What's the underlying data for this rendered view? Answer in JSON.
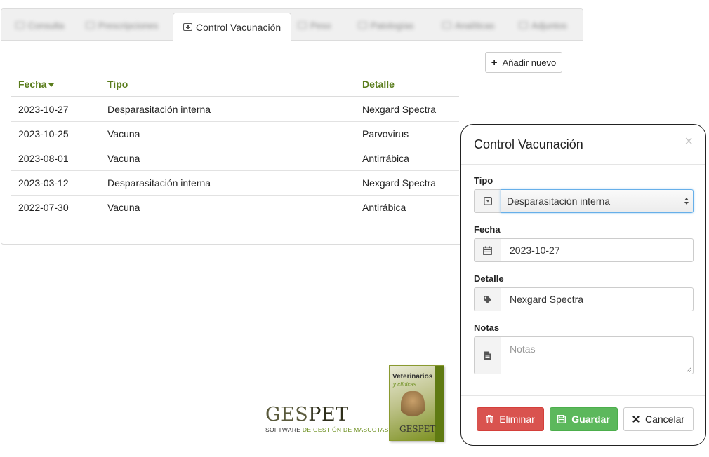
{
  "tabs": [
    {
      "label": "Consulta",
      "icon": "consulta-icon",
      "active": false
    },
    {
      "label": "Prescripciones",
      "icon": "list-icon",
      "active": false
    },
    {
      "label": "Control Vacunación",
      "icon": "medkit-icon",
      "active": true
    },
    {
      "label": "Peso",
      "icon": "weight-icon",
      "active": false
    },
    {
      "label": "Patologías",
      "icon": "pathology-icon",
      "active": false
    },
    {
      "label": "Analíticas",
      "icon": "analytics-icon",
      "active": false
    },
    {
      "label": "Adjuntos",
      "icon": "attachment-icon",
      "active": false
    }
  ],
  "toolbar": {
    "add_label": "Añadir nuevo",
    "add_icon": "plus-icon"
  },
  "table": {
    "columns": [
      "Fecha",
      "Tipo",
      "Detalle"
    ],
    "sort_column": "Fecha",
    "sort_direction": "desc",
    "rows": [
      {
        "fecha": "2023-10-27",
        "tipo": "Desparasitación interna",
        "detalle": "Nexgard Spectra"
      },
      {
        "fecha": "2023-10-25",
        "tipo": "Vacuna",
        "detalle": "Parvovirus"
      },
      {
        "fecha": "2023-08-01",
        "tipo": "Vacuna",
        "detalle": "Antirrábica"
      },
      {
        "fecha": "2023-03-12",
        "tipo": "Desparasitación interna",
        "detalle": "Nexgard Spectra"
      },
      {
        "fecha": "2022-07-30",
        "tipo": "Vacuna",
        "detalle": "Antirábica"
      }
    ]
  },
  "logo": {
    "brand_a": "GES",
    "brand_b": "PET",
    "tagline_a": "SOFTWARE ",
    "tagline_b": "DE GESTIÓN DE MASCOTAS",
    "box_title": "Veterinarios",
    "box_subtitle": "y clínicas",
    "box_brand": "GESPET"
  },
  "modal": {
    "title": "Control Vacunación",
    "close_glyph": "×",
    "fields": {
      "tipo": {
        "label": "Tipo",
        "value": "Desparasitación interna",
        "icon": "caret-square-icon"
      },
      "fecha": {
        "label": "Fecha",
        "value": "2023-10-27",
        "icon": "calendar-icon"
      },
      "detalle": {
        "label": "Detalle",
        "value": "Nexgard Spectra",
        "icon": "tag-icon"
      },
      "notas": {
        "label": "Notas",
        "value": "",
        "placeholder": "Notas",
        "icon": "file-icon"
      }
    },
    "buttons": {
      "delete": "Eliminar",
      "save": "Guardar",
      "cancel": "Cancelar"
    }
  },
  "colors": {
    "accent_green": "#5a7d1c",
    "danger": "#d9534f",
    "success": "#5cb85c",
    "focus": "#66afe9"
  }
}
